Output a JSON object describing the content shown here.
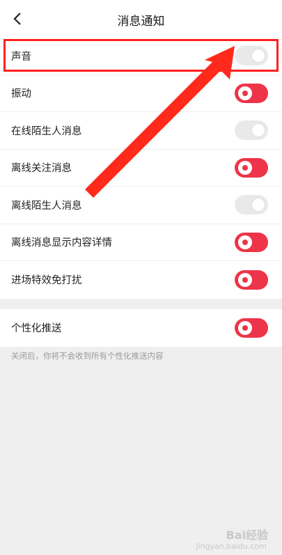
{
  "header": {
    "title": "消息通知"
  },
  "settings": [
    {
      "label": "声音",
      "on": false
    },
    {
      "label": "振动",
      "on": true
    },
    {
      "label": "在线陌生人消息",
      "on": false
    },
    {
      "label": "离线关注消息",
      "on": true
    },
    {
      "label": "离线陌生人消息",
      "on": false
    },
    {
      "label": "离线消息显示内容详情",
      "on": true
    },
    {
      "label": "进场特效免打扰",
      "on": true
    }
  ],
  "personalized": {
    "label": "个性化推送",
    "on": true,
    "hint": "关闭后，你将不会收到所有个性化推送内容"
  },
  "colors": {
    "accent": "#ee3448",
    "annotation": "#ff1f1f"
  },
  "watermark": {
    "brand": "Bai经验",
    "url": "jingyan.baidu.com"
  }
}
